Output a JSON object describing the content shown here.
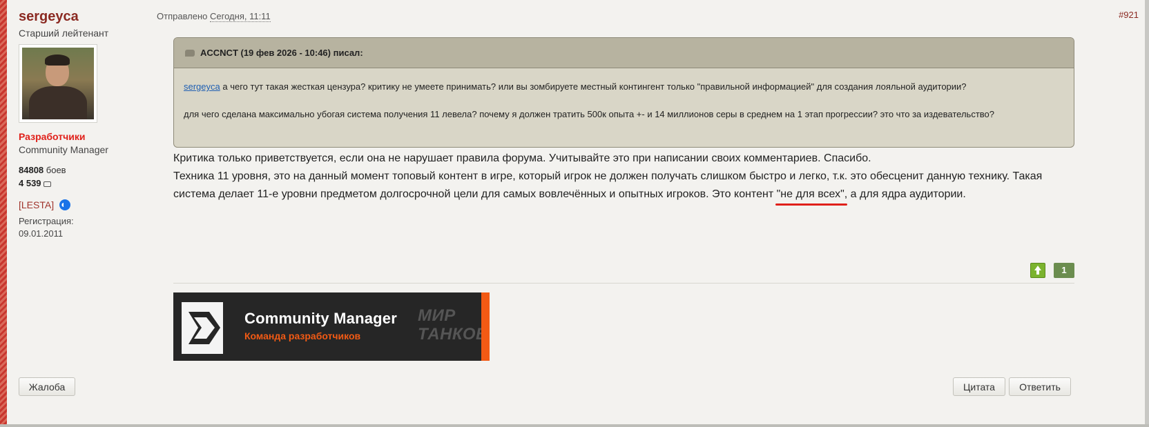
{
  "user": {
    "name": "sergeyca",
    "rank": "Старший лейтенант",
    "group": "Разработчики",
    "role": "Community Manager",
    "battles_count": "84808",
    "battles_label": "боев",
    "posts_count": "4 539",
    "clan": "[LESTA]",
    "registration_label": "Регистрация:",
    "registration_date": "09.01.2011"
  },
  "post": {
    "sent_label": "Отправлено",
    "time": "Сегодня, 11:11",
    "number": "#921"
  },
  "quote": {
    "header": "ACCNCT (19 фев 2026 - 10:46) писал:",
    "mention": "sergeyca",
    "line1": " а чего тут такая жесткая цензура? критику не умеете принимать? или вы зомбируете местный контингент только \"правильной информацией\" для создания лояльной аудитории?",
    "line2": "для чего сделана максимально убогая система получения 11 левела? почему я должен тратить 500к опыта +- и 14 миллионов серы в среднем на 1 этап прогрессии? это что за издевательство?"
  },
  "reply": {
    "line1": "Критика только приветствуется, если она не нарушает правила форума. Учитывайте это при написании своих комментариев. Спасибо.",
    "line2_before": "Техника 11 уровня, это на данный момент топовый контент в игре, который игрок не должен получать слишком быстро и легко, т.к. это обесценит данную технику. Такая система делает 11-е уровни предметом долгосрочной цели для самых вовлечённых и опытных игроков. Это контент ",
    "line2_highlight": "\"не для всех\"",
    "line2_after": ", а для ядра аудитории."
  },
  "votes": {
    "count": "1"
  },
  "signature": {
    "title": "Community Manager",
    "subtitle": "Команда разработчиков",
    "brand_line1": "МИР",
    "brand_line2": "ТАНКОВ"
  },
  "buttons": {
    "report": "Жалоба",
    "quote": "Цитата",
    "reply": "Ответить"
  },
  "colors": {
    "username": "#8b2a22",
    "group": "#e0201a",
    "link": "#1f5fb3",
    "vote_up": "#7bb32e",
    "vote_count": "#6b8d4f",
    "signature_accent": "#f25a14",
    "quote_header": "#b7b3a0",
    "quote_body": "#d9d6c7"
  }
}
